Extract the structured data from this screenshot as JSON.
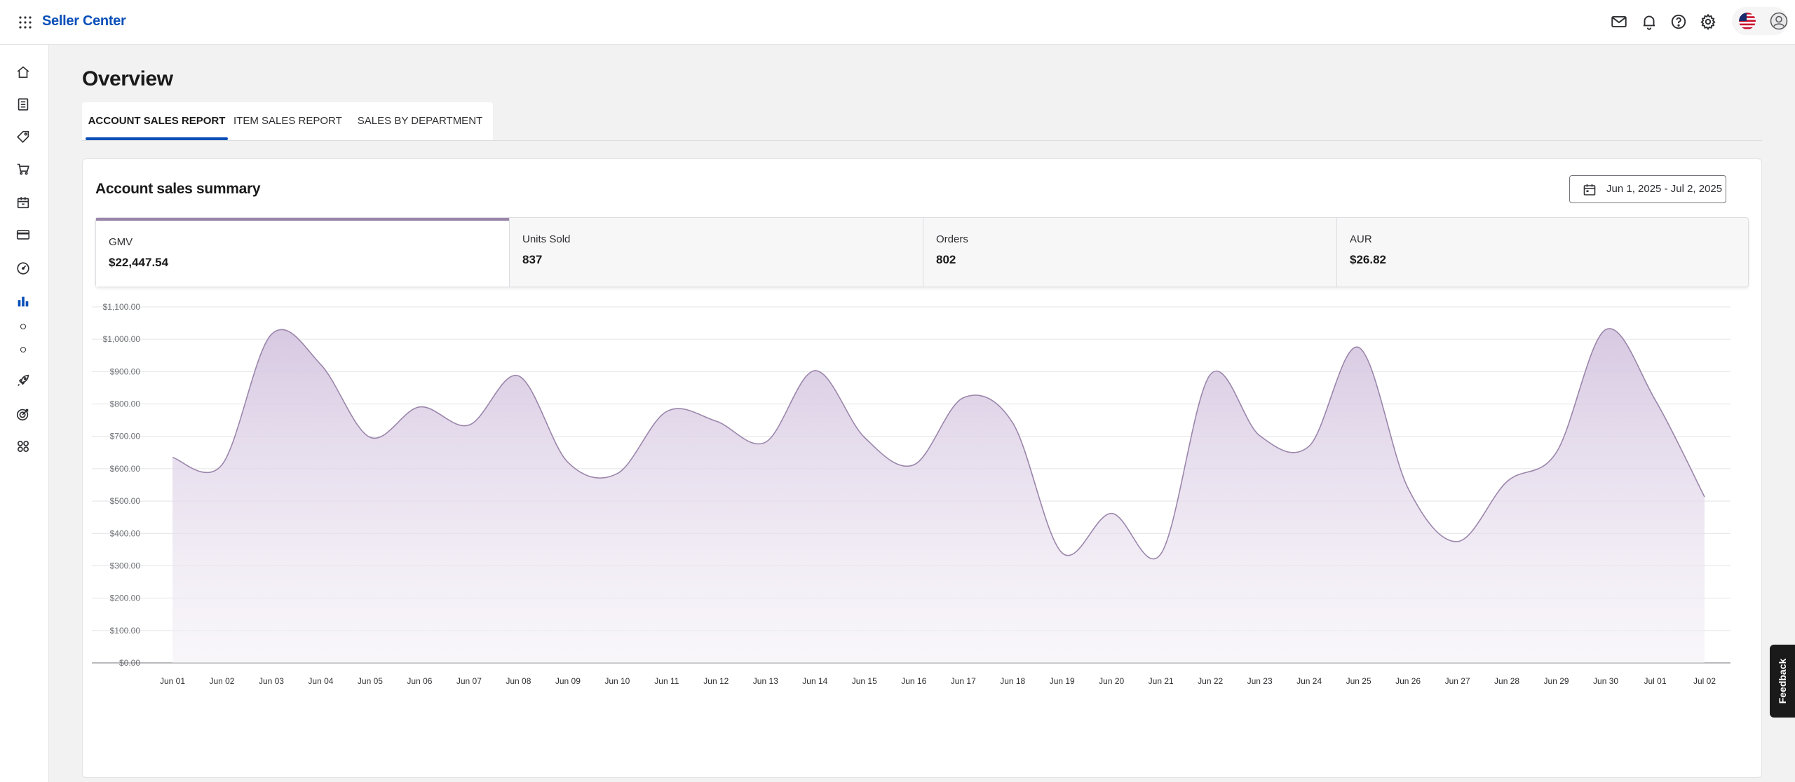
{
  "app": {
    "brand": "Seller Center"
  },
  "page": {
    "title": "Overview"
  },
  "tabs": [
    {
      "label": "ACCOUNT SALES REPORT",
      "active": true
    },
    {
      "label": "ITEM SALES REPORT",
      "active": false
    },
    {
      "label": "SALES BY DEPARTMENT",
      "active": false
    }
  ],
  "summary": {
    "title": "Account sales summary",
    "date_range": "Jun 1, 2025 - Jul 2, 2025",
    "metrics": [
      {
        "label": "GMV",
        "value": "$22,447.54",
        "active": true
      },
      {
        "label": "Units Sold",
        "value": "837",
        "active": false
      },
      {
        "label": "Orders",
        "value": "802",
        "active": false
      },
      {
        "label": "AUR",
        "value": "$26.82",
        "active": false
      }
    ]
  },
  "feedback": {
    "label": "Feedback"
  },
  "sidebar": {
    "items": [
      "home-icon",
      "orders-icon",
      "tag-icon",
      "cart-icon",
      "calendar-icon",
      "card-icon",
      "gauge-icon",
      "bar-chart-icon",
      "sub-item-dot",
      "sub-item-dot",
      "rocket-icon",
      "target-icon",
      "apps-icon"
    ]
  },
  "colors": {
    "brand": "#0a4fb8",
    "series": "#9b86ab",
    "fill": "#d9cce3"
  },
  "chart_data": {
    "type": "area",
    "x": [
      "Jun 01",
      "Jun 02",
      "Jun 03",
      "Jun 04",
      "Jun 05",
      "Jun 06",
      "Jun 07",
      "Jun 08",
      "Jun 09",
      "Jun 10",
      "Jun 11",
      "Jun 12",
      "Jun 13",
      "Jun 14",
      "Jun 15",
      "Jun 16",
      "Jun 17",
      "Jun 18",
      "Jun 19",
      "Jun 20",
      "Jun 21",
      "Jun 22",
      "Jun 23",
      "Jun 24",
      "Jun 25",
      "Jun 26",
      "Jun 27",
      "Jun 28",
      "Jun 29",
      "Jun 30",
      "Jul 01",
      "Jul 02"
    ],
    "series": [
      {
        "values": [
          635,
          612,
          1015,
          922,
          697,
          791,
          735,
          887,
          620,
          585,
          777,
          747,
          682,
          903,
          697,
          612,
          819,
          742,
          340,
          462,
          337,
          891,
          702,
          670,
          975,
          540,
          375,
          560,
          650,
          1030,
          813,
          513
        ]
      }
    ],
    "yticks": [
      "$0.00",
      "$100.00",
      "$200.00",
      "$300.00",
      "$400.00",
      "$500.00",
      "$600.00",
      "$700.00",
      "$800.00",
      "$900.00",
      "$1,000.00",
      "$1,100.00"
    ],
    "ylim": [
      0,
      1100
    ],
    "grid": true,
    "legend": "none"
  }
}
